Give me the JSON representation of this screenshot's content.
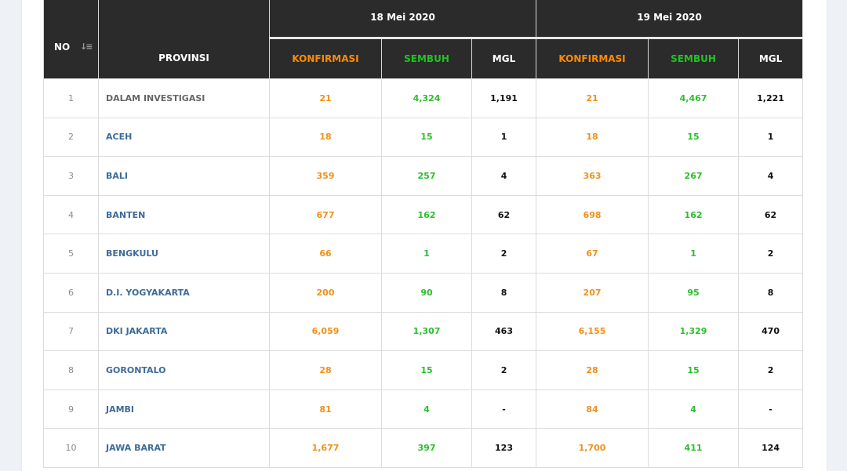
{
  "header": {
    "no_label": "NO",
    "sort_icon": "sort-descending-icon",
    "provinsi_label": "PROVINSI",
    "groups": [
      {
        "date": "18 Mei 2020",
        "cols": [
          "KONFIRMASI",
          "SEMBUH",
          "MGL"
        ]
      },
      {
        "date": "19 Mei 2020",
        "cols": [
          "KONFIRMASI",
          "SEMBUH",
          "MGL"
        ]
      }
    ]
  },
  "colors": {
    "konfirmasi": "#f0901a",
    "sembuh": "#2dbd2d",
    "header_bg": "#2b2b2b",
    "province_link": "#3d6b9a"
  },
  "rows": [
    {
      "no": "1",
      "provinsi": "DALAM INVESTIGASI",
      "d1": [
        "21",
        "4,324",
        "1,191"
      ],
      "d2": [
        "21",
        "4,467",
        "1,221"
      ]
    },
    {
      "no": "2",
      "provinsi": "ACEH",
      "d1": [
        "18",
        "15",
        "1"
      ],
      "d2": [
        "18",
        "15",
        "1"
      ]
    },
    {
      "no": "3",
      "provinsi": "BALI",
      "d1": [
        "359",
        "257",
        "4"
      ],
      "d2": [
        "363",
        "267",
        "4"
      ]
    },
    {
      "no": "4",
      "provinsi": "BANTEN",
      "d1": [
        "677",
        "162",
        "62"
      ],
      "d2": [
        "698",
        "162",
        "62"
      ]
    },
    {
      "no": "5",
      "provinsi": "BENGKULU",
      "d1": [
        "66",
        "1",
        "2"
      ],
      "d2": [
        "67",
        "1",
        "2"
      ]
    },
    {
      "no": "6",
      "provinsi": "D.I. YOGYAKARTA",
      "d1": [
        "200",
        "90",
        "8"
      ],
      "d2": [
        "207",
        "95",
        "8"
      ]
    },
    {
      "no": "7",
      "provinsi": "DKI JAKARTA",
      "d1": [
        "6,059",
        "1,307",
        "463"
      ],
      "d2": [
        "6,155",
        "1,329",
        "470"
      ]
    },
    {
      "no": "8",
      "provinsi": "GORONTALO",
      "d1": [
        "28",
        "15",
        "2"
      ],
      "d2": [
        "28",
        "15",
        "2"
      ]
    },
    {
      "no": "9",
      "provinsi": "JAMBI",
      "d1": [
        "81",
        "4",
        "-"
      ],
      "d2": [
        "84",
        "4",
        "-"
      ]
    },
    {
      "no": "10",
      "provinsi": "JAWA BARAT",
      "d1": [
        "1,677",
        "397",
        "123"
      ],
      "d2": [
        "1,700",
        "411",
        "124"
      ]
    }
  ]
}
